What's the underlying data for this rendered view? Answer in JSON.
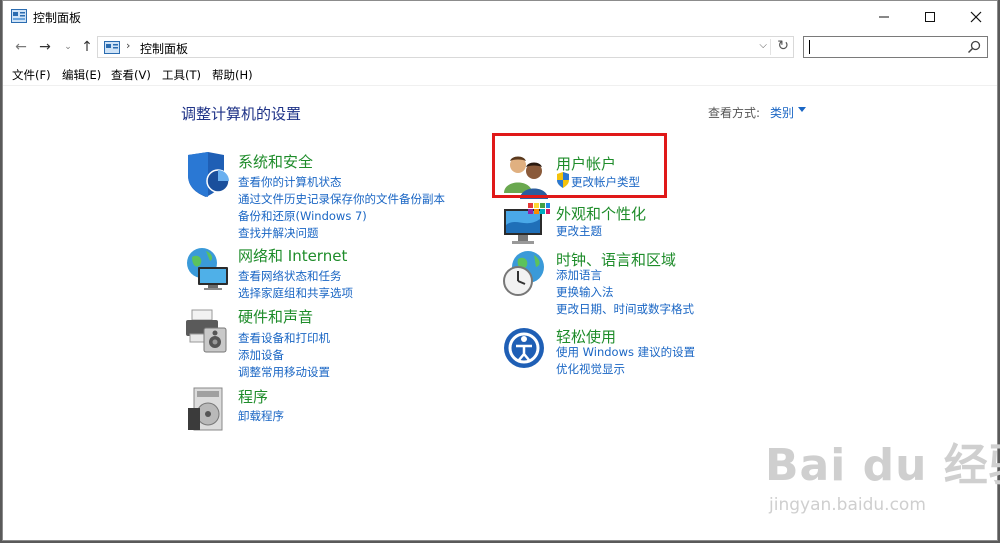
{
  "window": {
    "title": "控制面板"
  },
  "address": {
    "path": "控制面板",
    "search_placeholder": ""
  },
  "menu": [
    "文件(F)",
    "编辑(E)",
    "查看(V)",
    "工具(T)",
    "帮助(H)"
  ],
  "page": {
    "title": "调整计算机的设置",
    "view_by_label": "查看方式:",
    "view_by_value": "类别"
  },
  "categories": [
    {
      "title": "系统和安全",
      "links": [
        "查看你的计算机状态",
        "通过文件历史记录保存你的文件备份副本",
        "备份和还原(Windows 7)",
        "查找并解决问题"
      ]
    },
    {
      "title": "网络和 Internet",
      "links": [
        "查看网络状态和任务",
        "选择家庭组和共享选项"
      ]
    },
    {
      "title": "硬件和声音",
      "links": [
        "查看设备和打印机",
        "添加设备",
        "调整常用移动设置"
      ]
    },
    {
      "title": "程序",
      "links": [
        "卸载程序"
      ]
    },
    {
      "title": "用户帐户",
      "links": [
        "更改帐户类型"
      ]
    },
    {
      "title": "外观和个性化",
      "links": [
        "更改主题"
      ]
    },
    {
      "title": "时钟、语言和区域",
      "links": [
        "添加语言",
        "更换输入法",
        "更改日期、时间或数字格式"
      ]
    },
    {
      "title": "轻松使用",
      "links": [
        "使用 Windows 建议的设置",
        "优化视觉显示"
      ]
    }
  ],
  "watermark": {
    "brand": "Bai du 经验",
    "url": "jingyan.baidu.com"
  },
  "colors": {
    "link": "#1a66c4",
    "category_title": "#1e8c2a",
    "page_title": "#1e3287",
    "highlight": "#e01818"
  }
}
